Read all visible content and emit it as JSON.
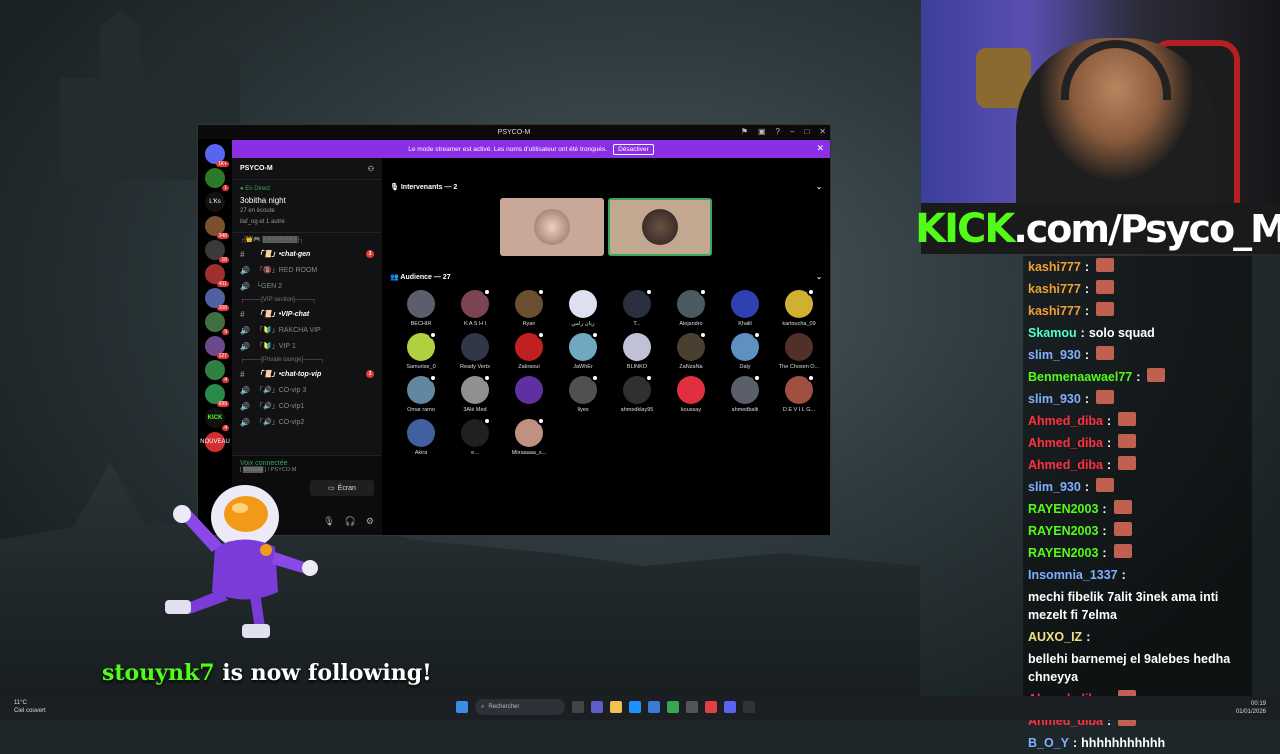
{
  "window": {
    "title": "PSYCO-M"
  },
  "banner": {
    "text": "Le mode streamer est activé. Les noms d'utilisateur ont été tronqués.",
    "button": "Désactiver"
  },
  "servers": [
    {
      "label": "",
      "badge": "1K+"
    },
    {
      "label": "",
      "badge": "1"
    },
    {
      "label": "L'Ks",
      "badge": ""
    },
    {
      "label": "",
      "badge": "348"
    },
    {
      "label": "",
      "badge": "18"
    },
    {
      "label": "",
      "badge": "411"
    },
    {
      "label": "",
      "badge": "108"
    },
    {
      "label": "",
      "badge": "9"
    },
    {
      "label": "",
      "badge": "127"
    },
    {
      "label": "",
      "badge": "4"
    },
    {
      "label": "",
      "badge": "699"
    },
    {
      "label": "KICK",
      "badge": "4"
    },
    {
      "label": "NOUVEAU",
      "badge": ""
    }
  ],
  "channels": {
    "server_name": "PSYCO-M",
    "live_tag": "● En Direct",
    "live_title": "3obitha night",
    "live_sub": "27 en écoute",
    "live_sub2": "ilaf_og et 1 autre",
    "cat1": "┌[👑🎮 ▓▓▓▓▓▓▓▓]┐",
    "ch1": "「📜」•chat-gen",
    "ch2": "「🔞」RED ROOM",
    "ch3": "└GEN 2",
    "cat2": "┌────[VIP section]────┐",
    "ch4": "「📜」•VIP-chat",
    "ch5": "「🔰」RAKCHA VIP",
    "ch6": "「🔰」VIP 1",
    "cat3": "┌────[Private lounge]────┐",
    "ch7": "「📜」•chat-top-vip",
    "ch8": "「🔊」CO-vip 3",
    "ch9": "「🔊」CO-vip1",
    "ch10": "「🔊」CO-vip2"
  },
  "voice": {
    "connected": "Voix connectée",
    "sub": "[ ▓▓▓▓▓ ] / PSYCO-M",
    "screen": "Écran"
  },
  "stage": {
    "speakers_label": "Intervenants — 2",
    "audience_label": "Audience — 27",
    "audience": [
      {
        "name": "BECHIR",
        "color": "#5a5f6b"
      },
      {
        "name": "K A S H I",
        "color": "#7a4550"
      },
      {
        "name": "Ryan",
        "color": "#6a5030"
      },
      {
        "name": "ريان رامي",
        "color": "#dde0ee"
      },
      {
        "name": "T...",
        "color": "#2a3040"
      },
      {
        "name": "Alejandro",
        "color": "#4a5a60"
      },
      {
        "name": "Khalil",
        "color": "#3040b0"
      },
      {
        "name": "kartoucha_09",
        "color": "#d0b030"
      },
      {
        "name": "Samurise_0",
        "color": "#b0d040"
      },
      {
        "name": "Ready Vertx",
        "color": "#303848"
      },
      {
        "name": "Zakraoui",
        "color": "#c02020"
      },
      {
        "name": "JaWhEr",
        "color": "#70a8c0"
      },
      {
        "name": "BLINKO",
        "color": "#c0c0d8"
      },
      {
        "name": "ZaNzaNa",
        "color": "#4a4030"
      },
      {
        "name": "Daly",
        "color": "#6090c0"
      },
      {
        "name": "The Chosen O...",
        "color": "#503028"
      },
      {
        "name": "Omar ramo",
        "color": "#6088a0"
      },
      {
        "name": "3Alé Med",
        "color": "#909090"
      },
      {
        "name": "",
        "color": "#6030a0"
      },
      {
        "name": "Ilyes",
        "color": "#505050"
      },
      {
        "name": "ahmedklay95",
        "color": "#303030"
      },
      {
        "name": "koussay",
        "color": "#e03040"
      },
      {
        "name": "ahmedbalti",
        "color": "#5a5f6b"
      },
      {
        "name": "D E V I L G...",
        "color": "#a05040"
      },
      {
        "name": "Akira",
        "color": "#4060a0"
      },
      {
        "name": "e...",
        "color": "#202020"
      },
      {
        "name": "Miiraaaaa_s...",
        "color": "#c09080"
      }
    ]
  },
  "kick_banner": {
    "brand": "KICK",
    "rest": ".com/Psyco_M"
  },
  "chat": [
    {
      "user": "kashi777",
      "color": "#f0a030",
      "text": "",
      "emote": true
    },
    {
      "user": "kashi777",
      "color": "#f0a030",
      "text": "",
      "emote": true
    },
    {
      "user": "kashi777",
      "color": "#f0a030",
      "text": "",
      "emote": true
    },
    {
      "user": "Skamou",
      "color": "#53fcd0",
      "text": "solo squad",
      "emote": false
    },
    {
      "user": "slim_930",
      "color": "#80b0ff",
      "text": "",
      "emote": true
    },
    {
      "user": "Benmenaawael77",
      "color": "#53fc18",
      "text": "",
      "emote": true
    },
    {
      "user": "slim_930",
      "color": "#80b0ff",
      "text": "",
      "emote": true
    },
    {
      "user": "Ahmed_diba",
      "color": "#ff3040",
      "text": "",
      "emote": true
    },
    {
      "user": "Ahmed_diba",
      "color": "#ff3040",
      "text": "",
      "emote": true
    },
    {
      "user": "Ahmed_diba",
      "color": "#ff3040",
      "text": "",
      "emote": true
    },
    {
      "user": "slim_930",
      "color": "#80b0ff",
      "text": "",
      "emote": true
    },
    {
      "user": "RAYEN2003",
      "color": "#53fc18",
      "text": "",
      "emote": true
    },
    {
      "user": "RAYEN2003",
      "color": "#53fc18",
      "text": "",
      "emote": true
    },
    {
      "user": "RAYEN2003",
      "color": "#53fc18",
      "text": "",
      "emote": true
    },
    {
      "user": "Insomnia_1337",
      "color": "#80b0ff",
      "text": "mechi fibelik 7alit 3inek ama inti mezelt fi 7elma",
      "emote": false
    },
    {
      "user": "AUXO_IZ",
      "color": "#f0e080",
      "text": "bellehi barnemej el 9alebes hedha chneyya",
      "emote": false
    },
    {
      "user": "Ahmed_diba",
      "color": "#ff3040",
      "text": "",
      "emote": true
    },
    {
      "user": "Ahmed_diba",
      "color": "#ff3040",
      "text": "",
      "emote": true
    },
    {
      "user": "B_O_Y",
      "color": "#80b0ff",
      "text": "hhhhhhhhhhh",
      "emote": false
    }
  ],
  "follow": {
    "user": "stouynk7",
    "text": " is now following!"
  },
  "taskbar": {
    "temp": "11°C",
    "weather": "Ciel couvert",
    "search": "Rechercher",
    "time": "00:19",
    "date": "01/01/2026"
  }
}
